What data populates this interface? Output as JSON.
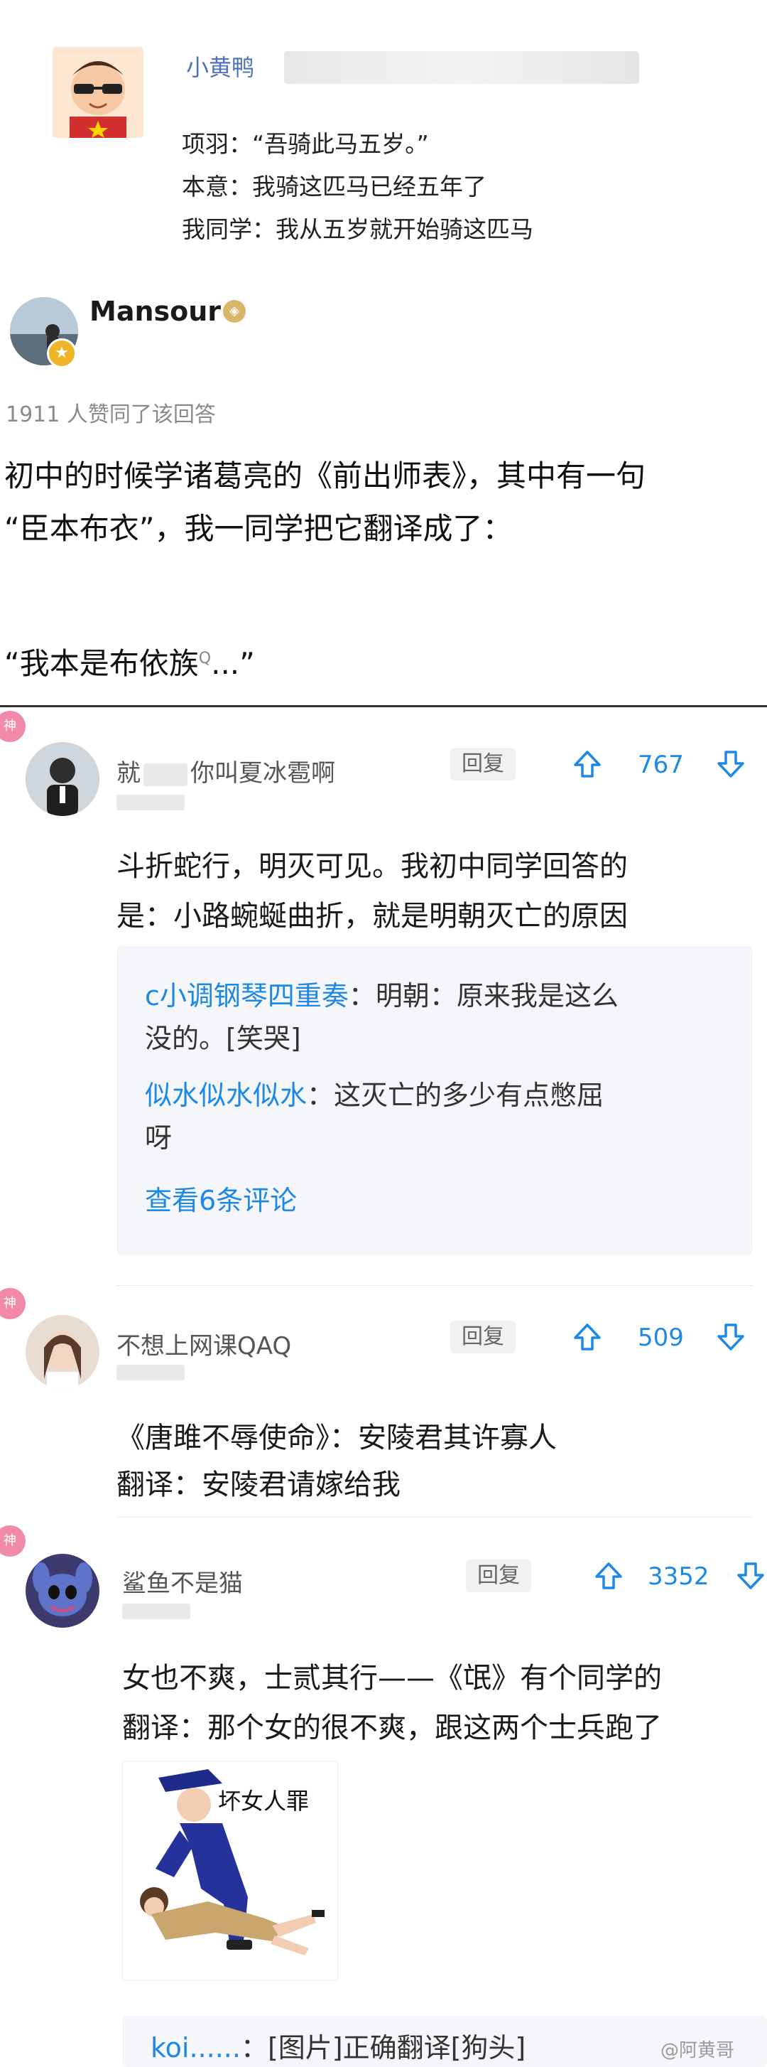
{
  "post1": {
    "username": "小黄鸭",
    "lines": [
      "项羽：“吾骑此马五岁。”",
      "本意：我骑这匹马已经五年了",
      "我同学：我从五岁就开始骑这匹马"
    ]
  },
  "post2": {
    "username": "Mansour",
    "likes": "1911 人赞同了该回答",
    "para": [
      "初中的时候学诸葛亮的《前出师表》，其中有一句",
      "“臣本布衣”，我一同学把它翻译成了："
    ],
    "quote": "“我本是布依族",
    "quote_tail": "...”"
  },
  "comments": [
    {
      "tag": "神",
      "name_prefix": "就",
      "name_suffix": "你叫夏冰雹啊",
      "reply": "回复",
      "count": "767",
      "text": [
        "斗折蛇行，明灭可见。我初中同学回答的",
        "是：小路蜿蜒曲折，就是明朝灭亡的原因"
      ],
      "subs": [
        {
          "name": "c小调钢琴四重奏",
          "lines": [
            "：明朝：原来我是这么",
            "没的。[笑哭]"
          ]
        },
        {
          "name": "似水似水似水",
          "lines": [
            "：这灭亡的多少有点憋屈",
            "呀"
          ]
        }
      ],
      "more": "查看6条评论"
    },
    {
      "tag": "神",
      "name": "不想上网课QAQ",
      "reply": "回复",
      "count": "509",
      "text": [
        "《唐雎不辱使命》：安陵君其许寡人",
        "翻译：安陵君请嫁给我"
      ]
    },
    {
      "tag": "神",
      "name": "鲨鱼不是猫",
      "reply": "回复",
      "count": "3352",
      "text": [
        "女也不爽，士贰其行——《氓》有个同学的",
        "翻译：那个女的很不爽，跟这两个士兵跑了"
      ],
      "image_caption": "坏女人罪",
      "sub": {
        "name": "koi",
        "dots": "......",
        "text": "：[图片]正确翻译[狗头]"
      }
    }
  ],
  "watermark": "@阿黄哥"
}
